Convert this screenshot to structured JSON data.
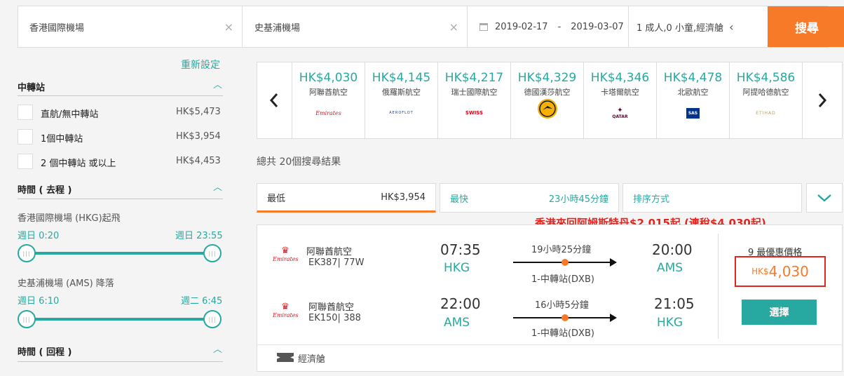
{
  "search": {
    "from": "香港國際機場",
    "to": "史基浦機場",
    "depart_date": "2019-02-17",
    "date_separator": "-",
    "return_date": "2019-03-07",
    "passengers": "1 成人,0 小童,經濟艙",
    "search_label": "搜尋",
    "clear_icon": "×",
    "collapse_icon": "‹"
  },
  "sidebar": {
    "reset_label": "重新設定",
    "stops": {
      "title": "中轉站",
      "options": [
        {
          "label": "直航/無中轉站",
          "price": "HK$5,473"
        },
        {
          "label": "1個中轉站",
          "price": "HK$3,954"
        },
        {
          "label": "2 個中轉站 或以上",
          "price": "HK$4,453"
        }
      ]
    },
    "time_out": {
      "title": "時間 ( 去程 )",
      "depart_label": "香港國際機場 (HKG)起飛",
      "depart_min": "週日 0:20",
      "depart_max": "週日 23:55",
      "arrive_label": "史基浦機場 (AMS) 降落",
      "arrive_min": "週日 6:10",
      "arrive_max": "週二 6:45"
    },
    "time_return": {
      "title": "時間 ( 回程 )"
    }
  },
  "carousel": {
    "items": [
      {
        "price": "HK$4,030",
        "airline": "阿聯酋航空",
        "logo": "Emirates"
      },
      {
        "price": "HK$4,145",
        "airline": "俄羅斯航空",
        "logo": "AEROFLOT"
      },
      {
        "price": "HK$4,217",
        "airline": "瑞士國際航空",
        "logo": "SWISS"
      },
      {
        "price": "HK$4,329",
        "airline": "德國漢莎航空",
        "logo": "lufthansa-crane"
      },
      {
        "price": "HK$4,346",
        "airline": "卡塔爾航空",
        "logo": "QATAR"
      },
      {
        "price": "HK$4,478",
        "airline": "北歐航空",
        "logo": "SAS"
      },
      {
        "price": "HK$4,586",
        "airline": "阿提哈德航空",
        "logo": "ETIHAD"
      }
    ]
  },
  "results": {
    "total_label": "總共 20個搜尋結果",
    "sort": {
      "cheapest_label": "最低",
      "cheapest_value": "HK$3,954",
      "fastest_label": "最快",
      "fastest_value": "23小時45分鐘",
      "order_label": "排序方式"
    },
    "promo": "香港來回阿姆斯特丹$2,015起 (連稅$4,030起)",
    "card": {
      "legs": [
        {
          "airline": "阿聯酋航空",
          "logo": "Emirates",
          "flight": "EK387| 77W",
          "dep_time": "07:35",
          "dep_code": "HKG",
          "duration": "19小時25分鐘",
          "stops": "1-中轉站(DXB)",
          "arr_time": "20:00",
          "arr_code": "AMS"
        },
        {
          "airline": "阿聯酋航空",
          "logo": "Emirates",
          "flight": "EK150| 388",
          "dep_time": "22:00",
          "dep_code": "AMS",
          "duration": "16小時5分鐘",
          "stops": "1-中轉站(DXB)",
          "arr_time": "21:05",
          "arr_code": "HKG"
        }
      ],
      "deals_label": "9 最優惠價格",
      "price_currency": "HK$",
      "price_value": "4,030",
      "select_label": "選擇",
      "cabin_label": "經濟艙"
    }
  },
  "colors": {
    "accent": "#27a9a1",
    "orange": "#f77a28",
    "red": "#e5241e"
  }
}
